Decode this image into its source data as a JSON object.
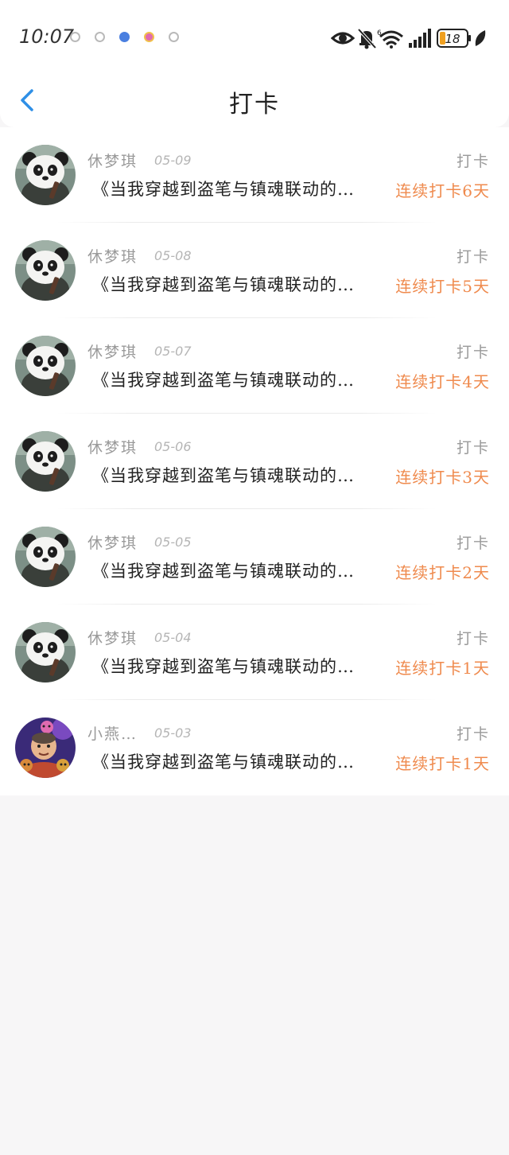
{
  "status_bar": {
    "time": "10:07",
    "battery": "18"
  },
  "header": {
    "title": "打卡"
  },
  "checkins": [
    {
      "name": "休梦琪",
      "date": "05-09",
      "type": "打卡",
      "book": "《当我穿越到盗笔与镇魂联动的…",
      "streak": "连续打卡6天",
      "avatar": "panda-avatar"
    },
    {
      "name": "休梦琪",
      "date": "05-08",
      "type": "打卡",
      "book": "《当我穿越到盗笔与镇魂联动的…",
      "streak": "连续打卡5天",
      "avatar": "panda-avatar"
    },
    {
      "name": "休梦琪",
      "date": "05-07",
      "type": "打卡",
      "book": "《当我穿越到盗笔与镇魂联动的…",
      "streak": "连续打卡4天",
      "avatar": "panda-avatar"
    },
    {
      "name": "休梦琪",
      "date": "05-06",
      "type": "打卡",
      "book": "《当我穿越到盗笔与镇魂联动的…",
      "streak": "连续打卡3天",
      "avatar": "panda-avatar"
    },
    {
      "name": "休梦琪",
      "date": "05-05",
      "type": "打卡",
      "book": "《当我穿越到盗笔与镇魂联动的…",
      "streak": "连续打卡2天",
      "avatar": "panda-avatar"
    },
    {
      "name": "休梦琪",
      "date": "05-04",
      "type": "打卡",
      "book": "《当我穿越到盗笔与镇魂联动的…",
      "streak": "连续打卡1天",
      "avatar": "panda-avatar"
    },
    {
      "name": "小燕…",
      "date": "05-03",
      "type": "打卡",
      "book": "《当我穿越到盗笔与镇魂联动的…",
      "streak": "连续打卡1天",
      "avatar": "cartoon-avatar"
    }
  ],
  "colors": {
    "accent_orange": "#ef8a4d",
    "back_blue": "#2f8fe6",
    "muted_text": "#9a9a9a",
    "background": "#f7f6f7"
  }
}
